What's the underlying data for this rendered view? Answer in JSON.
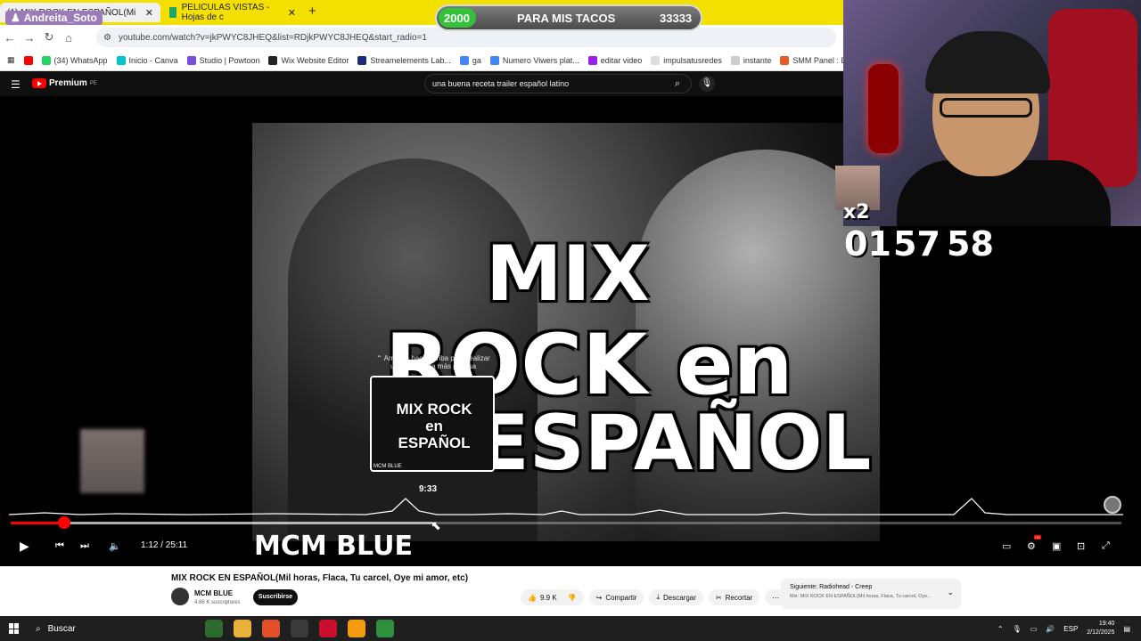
{
  "browser": {
    "tabs": [
      {
        "label": "(1) MIX ROCK EN ESPAÑOL(Mi",
        "close": "✕"
      },
      {
        "label": "PELICULAS VISTAS - Hojas de c",
        "close": "✕"
      }
    ],
    "new_tab": "+",
    "url": "youtube.com/watch?v=jkPWYC8JHEQ&list=RDjkPWYC8JHEQ&start_radio=1",
    "bookmarks": [
      {
        "label": "(34) WhatsApp",
        "color": "#25d366"
      },
      {
        "label": "Inicio - Canva",
        "color": "#00c4cc"
      },
      {
        "label": "Studio | Powtoon",
        "color": "#7a4dd8"
      },
      {
        "label": "Wix Website Editor",
        "color": "#222222"
      },
      {
        "label": "Streamelements Lab...",
        "color": "#1b2a7a"
      },
      {
        "label": "ga",
        "color": "#4285f4"
      },
      {
        "label": "Numero Viwers plat...",
        "color": "#4285f4"
      },
      {
        "label": "editar video",
        "color": "#9b1fe8"
      },
      {
        "label": "impulsatusredes",
        "color": "#dddddd"
      },
      {
        "label": "instante",
        "color": "#cccccc"
      },
      {
        "label": "SMM Panel : Best &...",
        "color": "#e85a2a"
      }
    ]
  },
  "overlay": {
    "goal_current": "2000",
    "goal_label": "PARA MIS TACOS",
    "goal_target": "33333",
    "username": "Andreita_Soto",
    "combo": "x2",
    "timer": {
      "h": "01",
      "m": "57",
      "s": "58"
    }
  },
  "youtube": {
    "logo": "Premium",
    "region": "PE",
    "search_value": "una buena receta trailer español latino"
  },
  "player": {
    "thumb_lines": [
      "MIX",
      "ROCK en",
      "ESPAÑOL"
    ],
    "seek_hint": "Arrastra hacia arriba para realizar una búsqueda más precisa",
    "preview_title": "MIX ROCK en ESPAÑOL",
    "preview_channel": "MCM BLUE",
    "preview_time": "9:33",
    "time": "1:12 / 25:11",
    "channel_overlay": "MCM BLUE",
    "progress_played": 0.048,
    "progress_buffered": 0.38,
    "hd_badge": "HD"
  },
  "video": {
    "title": "MIX ROCK EN ESPAÑOL(Mil horas, Flaca, Tu carcel, Oye mi amor, etc)",
    "channel": "MCM BLUE",
    "subscribers": "4.88 K suscriptores",
    "subscribe": "Suscribirse",
    "likes": "9.9 K",
    "share": "Compartir",
    "download": "Descargar",
    "clip": "Recortar",
    "next_title": "Siguiente: Radiohead - Creep",
    "next_sub": "Mix: MIX ROCK EN ESPAÑOL(Mil horas, Flaca, Tu carcel, Oye..."
  },
  "taskbar": {
    "search": "Buscar",
    "lang": "ESP",
    "time": "19:40",
    "date": "2/12/2025"
  }
}
